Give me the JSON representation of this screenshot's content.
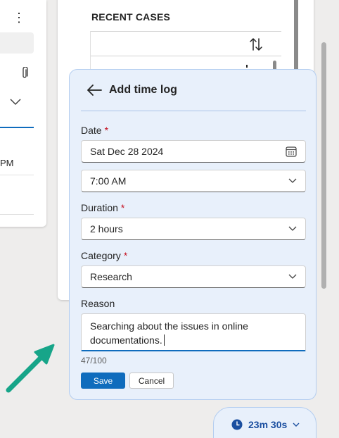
{
  "left_card": {
    "time_fragment": "PM"
  },
  "recent_cases": {
    "title": "RECENT CASES"
  },
  "add_time_log": {
    "title": "Add time log",
    "date": {
      "label": "Date",
      "required_marker": "*",
      "value": "Sat Dec 28 2024"
    },
    "time": {
      "value": "7:00 AM"
    },
    "duration": {
      "label": "Duration",
      "required_marker": "*",
      "value": "2 hours"
    },
    "category": {
      "label": "Category",
      "required_marker": "*",
      "value": "Research"
    },
    "reason": {
      "label": "Reason",
      "line1": "Searching about the issues in online",
      "line2": "documentations.",
      "counter": "47/100"
    },
    "save_label": "Save",
    "cancel_label": "Cancel"
  },
  "timer": {
    "value": "23m 30s"
  },
  "colors": {
    "accent": "#0f6cbd",
    "panel_bg": "#e8f0fb",
    "required": "#c50f1f",
    "annotation_arrow": "#17a589"
  }
}
